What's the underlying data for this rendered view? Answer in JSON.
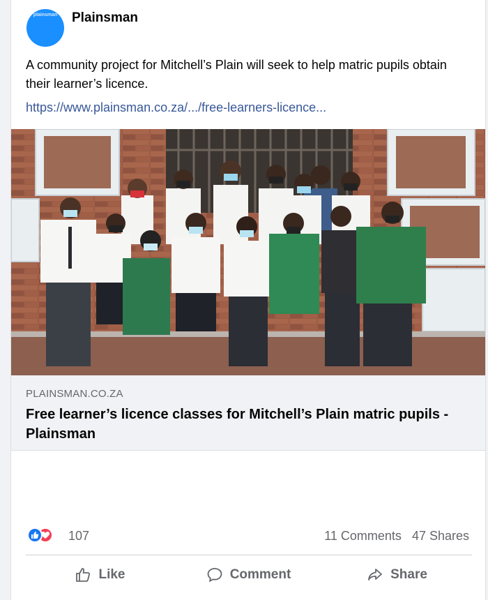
{
  "post": {
    "page_name": "Plainsman",
    "avatar_text": "plainsman",
    "text": "A community project for Mitchell’s Plain will seek to help matric pupils obtain their learner’s licence.",
    "link": "https://www.plainsman.co.za/.../free-learners-licence..."
  },
  "preview": {
    "domain": "PLAINSMAN.CO.ZA",
    "title": "Free learner’s licence classes for Mitchell’s Plain matric pupils - Plainsman"
  },
  "stats": {
    "reactions": [
      "like-icon",
      "love-icon"
    ],
    "reaction_count": "107",
    "comments": "11 Comments",
    "shares": "47 Shares"
  },
  "actions": {
    "like": "Like",
    "comment": "Comment",
    "share": "Share"
  },
  "colors": {
    "link": "#385898",
    "brand": "#1877f2",
    "love": "#f33e58",
    "muted": "#65676b"
  }
}
